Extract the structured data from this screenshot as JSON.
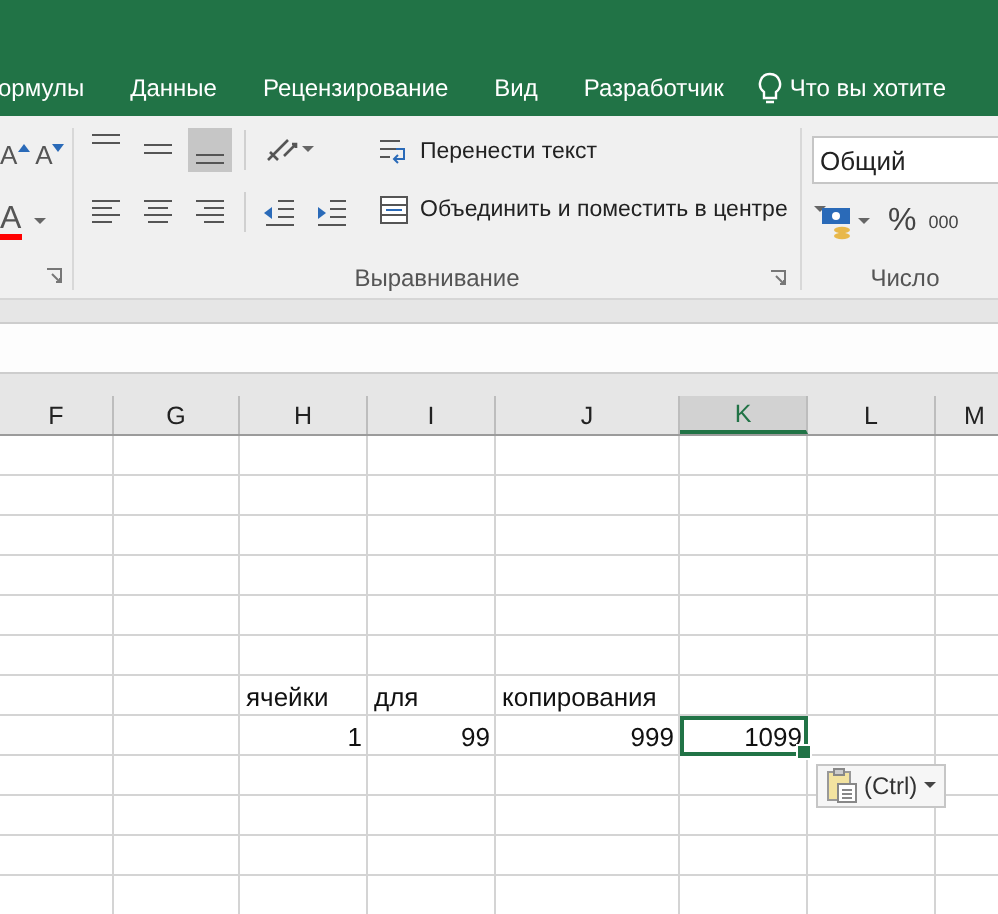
{
  "menu": {
    "tabs": [
      {
        "label": "ормулы",
        "selected": false
      },
      {
        "label": "Данные",
        "selected": false
      },
      {
        "label": "Рецензирование",
        "selected": false
      },
      {
        "label": "Вид",
        "selected": false
      },
      {
        "label": "Разработчик",
        "selected": false
      }
    ],
    "search": {
      "placeholder": "Что вы хотите"
    }
  },
  "ribbon": {
    "font": {
      "size_buttons": [
        {
          "kind": "grow",
          "glyph": "A"
        },
        {
          "kind": "shrink",
          "glyph": "A"
        }
      ],
      "color_button": {
        "glyph": "A",
        "color": "#ff0000"
      }
    },
    "alignment": {
      "vertical": [
        {
          "kind": "top",
          "selected": false
        },
        {
          "kind": "middle",
          "selected": false
        },
        {
          "kind": "bottom",
          "selected": true
        }
      ],
      "horizontal": [
        {
          "kind": "left",
          "selected": false
        },
        {
          "kind": "center",
          "selected": false
        },
        {
          "kind": "right",
          "selected": false
        }
      ],
      "wrap_text": "Перенести текст",
      "merge": "Объединить и поместить в центре",
      "label": "Выравнивание"
    },
    "number": {
      "format": "Общий",
      "percent": "%",
      "thousands": "000",
      "label": "Число"
    }
  },
  "sheet": {
    "columns": [
      {
        "label": "F",
        "selected": false
      },
      {
        "label": "G",
        "selected": false
      },
      {
        "label": "H",
        "selected": false
      },
      {
        "label": "I",
        "selected": false
      },
      {
        "label": "J",
        "selected": false
      },
      {
        "label": "K",
        "selected": true
      },
      {
        "label": "L",
        "selected": false
      },
      {
        "label": "M",
        "selected": false
      }
    ],
    "rows": [
      {
        "cells": [
          null,
          null,
          null,
          null,
          null,
          null,
          null,
          null
        ]
      },
      {
        "cells": [
          null,
          null,
          null,
          null,
          null,
          null,
          null,
          null
        ]
      },
      {
        "cells": [
          null,
          null,
          null,
          null,
          null,
          null,
          null,
          null
        ]
      },
      {
        "cells": [
          null,
          null,
          null,
          null,
          null,
          null,
          null,
          null
        ]
      },
      {
        "cells": [
          null,
          null,
          null,
          null,
          null,
          null,
          null,
          null
        ]
      },
      {
        "cells": [
          null,
          null,
          null,
          null,
          null,
          null,
          null,
          null
        ]
      },
      {
        "cells": [
          null,
          null,
          {
            "text": "ячейки",
            "kind": "text",
            "selected": false
          },
          {
            "text": "для",
            "kind": "text",
            "selected": false
          },
          {
            "text": "копирования",
            "kind": "text",
            "selected": false
          },
          null,
          null,
          null
        ]
      },
      {
        "cells": [
          null,
          null,
          {
            "text": "1",
            "kind": "number",
            "selected": false
          },
          {
            "text": "99",
            "kind": "number",
            "selected": false
          },
          {
            "text": "999",
            "kind": "number",
            "selected": false
          },
          {
            "text": "1099",
            "kind": "number",
            "selected": true
          },
          null,
          null
        ]
      },
      {
        "cells": [
          null,
          null,
          null,
          null,
          null,
          null,
          null,
          null
        ]
      },
      {
        "cells": [
          null,
          null,
          null,
          null,
          null,
          null,
          null,
          null
        ]
      },
      {
        "cells": [
          null,
          null,
          null,
          null,
          null,
          null,
          null,
          null
        ]
      },
      {
        "cells": [
          null,
          null,
          null,
          null,
          null,
          null,
          null,
          null
        ]
      }
    ],
    "paste_options": {
      "label": "(Ctrl)"
    }
  }
}
